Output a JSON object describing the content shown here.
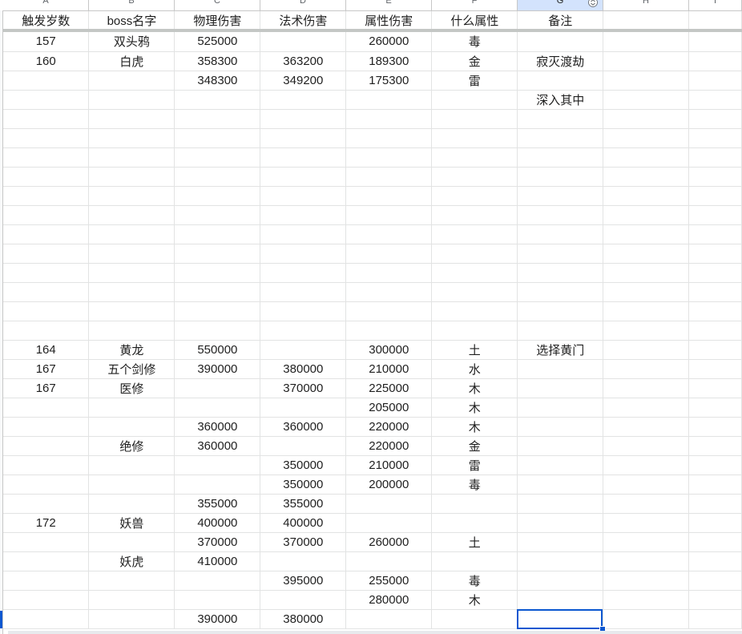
{
  "columns": [
    "A",
    "B",
    "C",
    "D",
    "E",
    "F",
    "G",
    "H",
    "I"
  ],
  "selected_column_index": 6,
  "header": [
    "触发岁数",
    "boss名字",
    "物理伤害",
    "法术伤害",
    "属性伤害",
    "什么属性",
    "备注",
    "",
    ""
  ],
  "rows": [
    [
      "157",
      "双头鸦",
      "525000",
      "",
      "260000",
      "毒",
      "",
      "",
      ""
    ],
    [
      "160",
      "白虎",
      "358300",
      "363200",
      "189300",
      "金",
      "寂灭渡劫",
      "",
      ""
    ],
    [
      "",
      "",
      "348300",
      "349200",
      "175300",
      "雷",
      "",
      "",
      ""
    ],
    [
      "",
      "",
      "",
      "",
      "",
      "",
      "深入其中",
      "",
      ""
    ],
    [
      "",
      "",
      "",
      "",
      "",
      "",
      "",
      "",
      ""
    ],
    [
      "",
      "",
      "",
      "",
      "",
      "",
      "",
      "",
      ""
    ],
    [
      "",
      "",
      "",
      "",
      "",
      "",
      "",
      "",
      ""
    ],
    [
      "",
      "",
      "",
      "",
      "",
      "",
      "",
      "",
      ""
    ],
    [
      "",
      "",
      "",
      "",
      "",
      "",
      "",
      "",
      ""
    ],
    [
      "",
      "",
      "",
      "",
      "",
      "",
      "",
      "",
      ""
    ],
    [
      "",
      "",
      "",
      "",
      "",
      "",
      "",
      "",
      ""
    ],
    [
      "",
      "",
      "",
      "",
      "",
      "",
      "",
      "",
      ""
    ],
    [
      "",
      "",
      "",
      "",
      "",
      "",
      "",
      "",
      ""
    ],
    [
      "",
      "",
      "",
      "",
      "",
      "",
      "",
      "",
      ""
    ],
    [
      "",
      "",
      "",
      "",
      "",
      "",
      "",
      "",
      ""
    ],
    [
      "",
      "",
      "",
      "",
      "",
      "",
      "",
      "",
      ""
    ],
    [
      "164",
      "黄龙",
      "550000",
      "",
      "300000",
      "土",
      "选择黄门",
      "",
      ""
    ],
    [
      "167",
      "五个剑修",
      "390000",
      "380000",
      "210000",
      "水",
      "",
      "",
      ""
    ],
    [
      "167",
      "医修",
      "",
      "370000",
      "225000",
      "木",
      "",
      "",
      ""
    ],
    [
      "",
      "",
      "",
      "",
      "205000",
      "木",
      "",
      "",
      ""
    ],
    [
      "",
      "",
      "360000",
      "360000",
      "220000",
      "木",
      "",
      "",
      ""
    ],
    [
      "",
      "绝修",
      "360000",
      "",
      "220000",
      "金",
      "",
      "",
      ""
    ],
    [
      "",
      "",
      "",
      "350000",
      "210000",
      "雷",
      "",
      "",
      ""
    ],
    [
      "",
      "",
      "",
      "350000",
      "200000",
      "毒",
      "",
      "",
      ""
    ],
    [
      "",
      "",
      "355000",
      "355000",
      "",
      "",
      "",
      "",
      ""
    ],
    [
      "172",
      "妖兽",
      "400000",
      "400000",
      "",
      "",
      "",
      "",
      ""
    ],
    [
      "",
      "",
      "370000",
      "370000",
      "260000",
      "土",
      "",
      "",
      ""
    ],
    [
      "",
      "妖虎",
      "410000",
      "",
      "",
      "",
      "",
      "",
      ""
    ],
    [
      "",
      "",
      "",
      "395000",
      "255000",
      "毒",
      "",
      "",
      ""
    ],
    [
      "",
      "",
      "",
      "",
      "280000",
      "木",
      "",
      "",
      ""
    ],
    [
      "",
      "",
      "390000",
      "380000",
      "",
      "",
      "",
      "",
      ""
    ]
  ],
  "selected_cell": {
    "row": 30,
    "col": 6
  },
  "icons": {
    "sort_icon": "sort-arrows-icon"
  },
  "colors": {
    "accent": "#0b57d0",
    "grid": "#e2e3e3",
    "header_selected": "#d3e3fd"
  }
}
